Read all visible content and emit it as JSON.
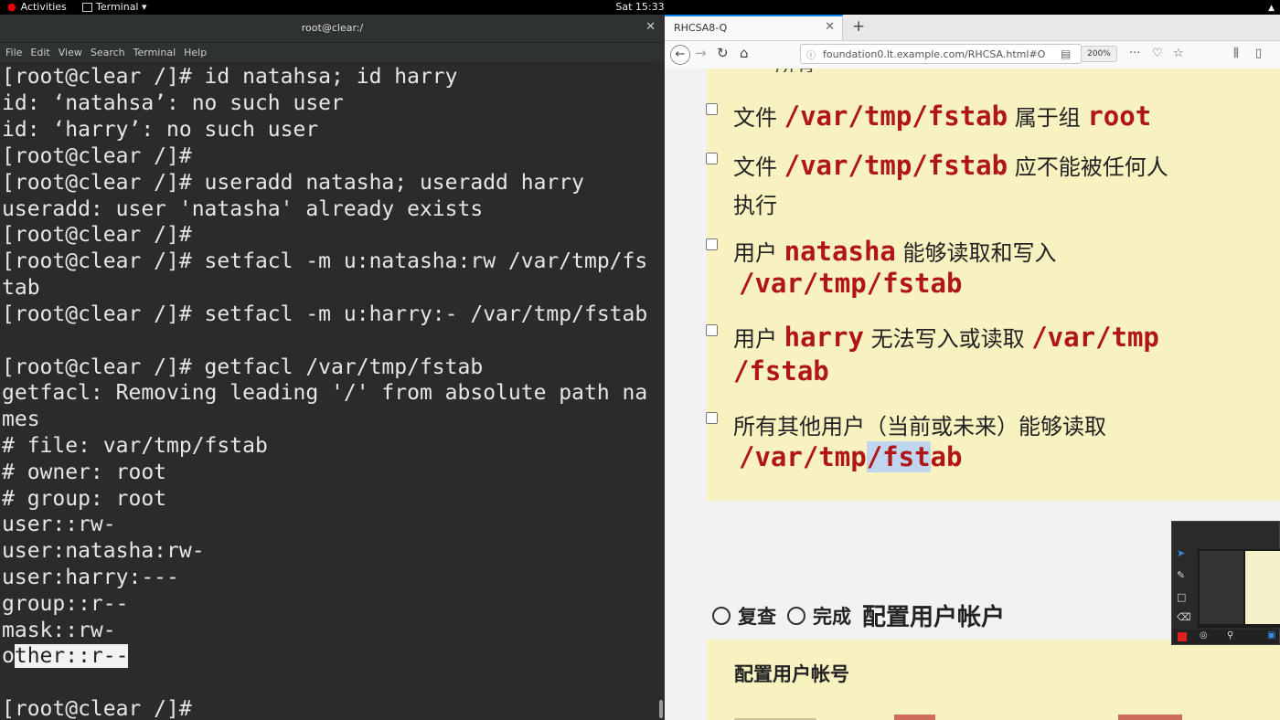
{
  "topbar": {
    "activities": "Activities",
    "app_menu": "Terminal ▾",
    "clock": "Sat 15:33"
  },
  "terminal": {
    "title": "root@clear:/",
    "menu": [
      "File",
      "Edit",
      "View",
      "Search",
      "Terminal",
      "Help"
    ],
    "lines": [
      "[root@clear /]# id natahsa; id harry",
      "id: ‘natahsa’: no such user",
      "id: ‘harry’: no such user",
      "[root@clear /]#",
      "[root@clear /]# useradd natasha; useradd harry",
      "useradd: user 'natasha' already exists",
      "[root@clear /]#",
      "[root@clear /]# setfacl -m u:natasha:rw /var/tmp/fs",
      "tab",
      "[root@clear /]# setfacl -m u:harry:- /var/tmp/fstab",
      "",
      "[root@clear /]# getfacl /var/tmp/fstab",
      "getfacl: Removing leading '/' from absolute path na",
      "mes",
      "# file: var/tmp/fstab",
      "# owner: root",
      "# group: root",
      "user::rw-",
      "user:natasha:rw-",
      "user:harry:---",
      "group::r--",
      "mask::rw-",
      "",
      "",
      "[root@clear /]#"
    ],
    "other_line": {
      "first": "o",
      "highlighted": "ther::r--"
    }
  },
  "browser": {
    "tab_title": "RHCSA8-Q",
    "url": "foundation0.lt.example.com/RHCSA.html#O",
    "zoom": "200%",
    "tasks": [
      {
        "pre": "文件 ",
        "code": "/var/tmp/fstab",
        "post": " 属于组 ",
        "code2": "root"
      },
      {
        "pre": "文件 ",
        "code": "/var/tmp/fstab",
        "post": " 应不能被任何人",
        "line2": "执行"
      },
      {
        "pre": "用户 ",
        "code": "natasha",
        "post": " 能够读取和写入",
        "code_line2": "/var/tmp/fstab"
      },
      {
        "pre": "用户 ",
        "code": "harry",
        "post": " 无法写入或读取 ",
        "code2": "/var/tmp",
        "code_line2": "/fstab"
      },
      {
        "pre": "所有其他用户（当前或未来）能够读取",
        "code_line2_a": "/var/tmp",
        "code_line2_sel": "/fst",
        "code_line2_b": "ab"
      }
    ],
    "section": {
      "review": "复查",
      "done": "完成",
      "title": "配置用户帐户"
    },
    "subpanel_title": "配置用户帐号"
  }
}
